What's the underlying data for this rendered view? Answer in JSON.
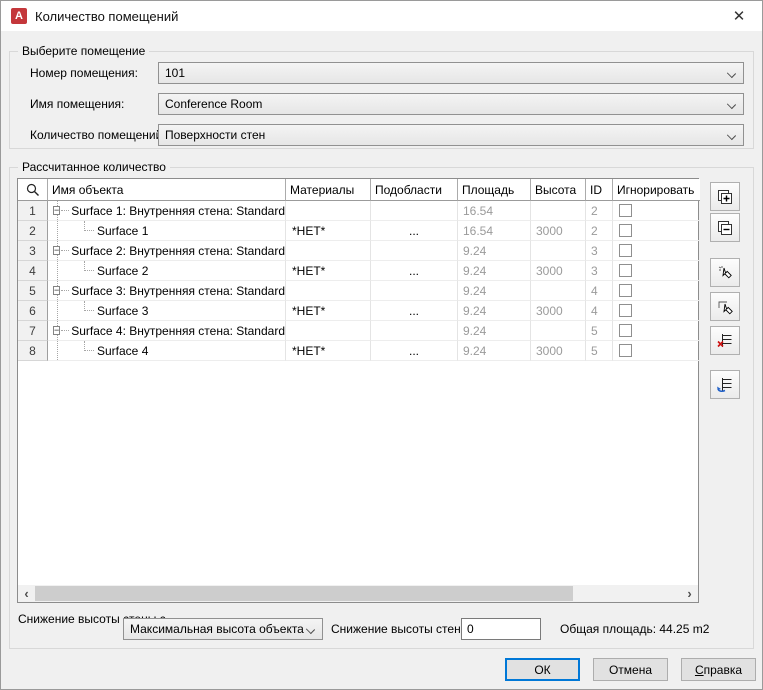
{
  "window": {
    "title": "Количество помещений",
    "app_icon_letter": "A",
    "close_glyph": "✕"
  },
  "select_space": {
    "group_label": "Выберите помещение",
    "fields": [
      {
        "label": "Номер помещения:",
        "value": "101"
      },
      {
        "label": "Имя помещения:",
        "value": "Conference Room"
      },
      {
        "label": "Количество помещений:",
        "value": "Поверхности стен"
      }
    ]
  },
  "calculated": {
    "group_label": "Рассчитанное количество",
    "columns": [
      "Имя объекта",
      "Материалы",
      "Подобласти",
      "Площадь",
      "Высота",
      "ID",
      "Игнорировать"
    ],
    "rows": [
      {
        "num": "1",
        "type": "parent",
        "name": "Surface 1: Внутренняя стена: Standard",
        "materials": "",
        "subareas": "",
        "area": "16.54",
        "height": "",
        "id": "2"
      },
      {
        "num": "2",
        "type": "child",
        "name": "Surface 1",
        "materials": "*НЕТ*",
        "subareas": "...",
        "area": "16.54",
        "height": "3000",
        "id": "2"
      },
      {
        "num": "3",
        "type": "parent",
        "name": "Surface 2: Внутренняя стена: Standard",
        "materials": "",
        "subareas": "",
        "area": "9.24",
        "height": "",
        "id": "3"
      },
      {
        "num": "4",
        "type": "child",
        "name": "Surface 2",
        "materials": "*НЕТ*",
        "subareas": "...",
        "area": "9.24",
        "height": "3000",
        "id": "3"
      },
      {
        "num": "5",
        "type": "parent",
        "name": "Surface 3: Внутренняя стена: Standard",
        "materials": "",
        "subareas": "",
        "area": "9.24",
        "height": "",
        "id": "4"
      },
      {
        "num": "6",
        "type": "child",
        "name": "Surface 3",
        "materials": "*НЕТ*",
        "subareas": "...",
        "area": "9.24",
        "height": "3000",
        "id": "4"
      },
      {
        "num": "7",
        "type": "parent",
        "name": "Surface 4: Внутренняя стена: Standard",
        "materials": "",
        "subareas": "",
        "area": "9.24",
        "height": "",
        "id": "5"
      },
      {
        "num": "8",
        "type": "child",
        "name": "Surface 4",
        "materials": "*НЕТ*",
        "subareas": "...",
        "area": "9.24",
        "height": "3000",
        "id": "5"
      }
    ],
    "scrollbar": {
      "left_glyph": "‹",
      "right_glyph": "›"
    }
  },
  "bottom": {
    "wall_height_from_label": "Снижение высоты стены с",
    "wall_height_from_value": "Максимальная высота объекта",
    "wall_reduction_label": "Снижение высоты стен",
    "wall_reduction_value": "0",
    "total_area_label": "Общая площадь:",
    "total_area_value": "44.25 m2"
  },
  "buttons": {
    "ok": "ОК",
    "cancel": "Отмена",
    "help": "Справка"
  }
}
